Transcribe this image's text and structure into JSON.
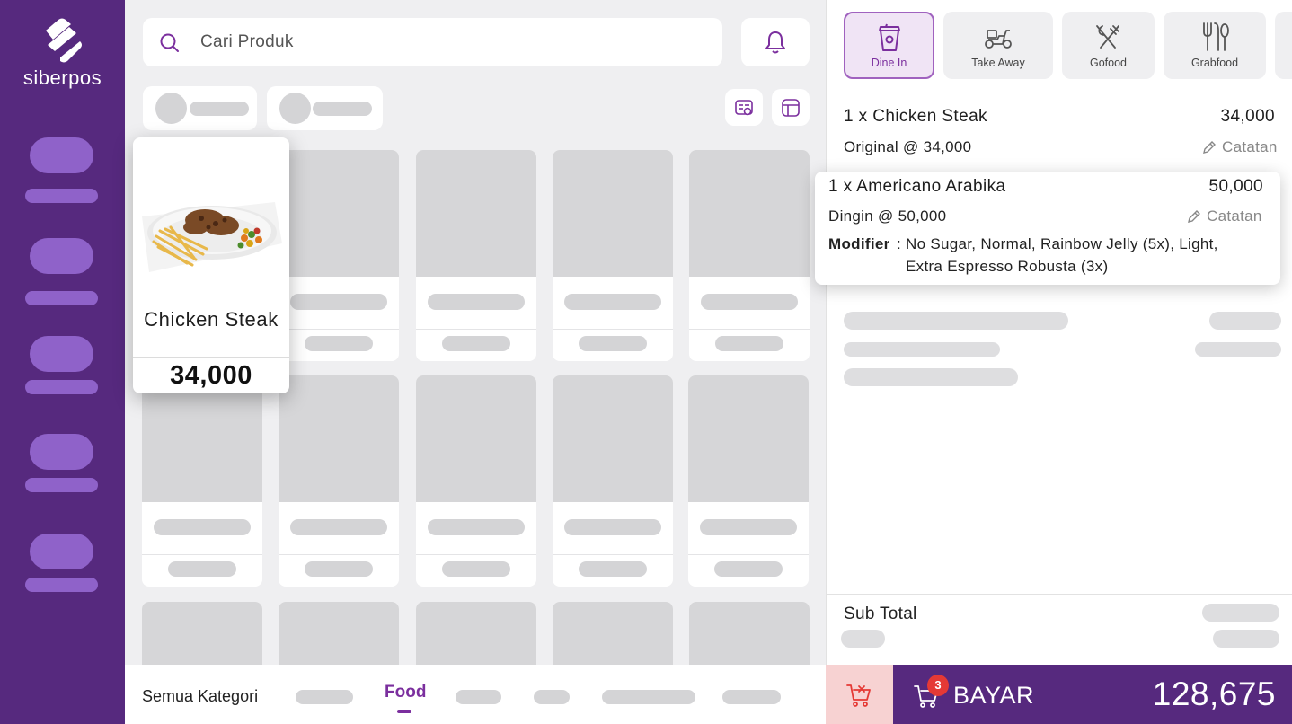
{
  "brand": {
    "name": "siberpos",
    "logo_icon": "siberpos-logo-icon"
  },
  "search": {
    "placeholder": "Cari Produk",
    "icon": "search-icon"
  },
  "header": {
    "notification_icon": "bell-icon"
  },
  "featured_product": {
    "name": "Chicken Steak",
    "price": "34,000",
    "image_icon": "steak-plate-icon"
  },
  "categories": {
    "all_label": "Semua Kategori",
    "active_label": "Food"
  },
  "order_types": [
    {
      "label": "Dine In",
      "icon": "cup-icon",
      "active": true
    },
    {
      "label": "Take Away",
      "icon": "scooter-icon",
      "active": false
    },
    {
      "label": "Gofood",
      "icon": "fork-knife-icon",
      "active": false
    },
    {
      "label": "Grabfood",
      "icon": "utensils-icon",
      "active": false
    }
  ],
  "order_items": [
    {
      "title": "1 x Chicken Steak",
      "amount": "34,000",
      "variant": "Original @ 34,000",
      "note_label": "Catatan"
    },
    {
      "title": "1 x Americano Arabika",
      "amount": "50,000",
      "variant": "Dingin @ 50,000",
      "note_label": "Catatan",
      "modifier_label": "Modifier",
      "modifier_sep": ":",
      "modifier_line1": "No Sugar, Normal, Rainbow Jelly (5x), Light,",
      "modifier_line2": "Extra Espresso Robusta (3x)"
    }
  ],
  "summary": {
    "subtotal_label": "Sub Total"
  },
  "checkout": {
    "pay_label": "BAYAR",
    "total": "128,675",
    "cart_count": "3",
    "colors": {
      "primary": "#56297e",
      "accent": "#7b2f9e",
      "danger": "#e53935"
    }
  }
}
